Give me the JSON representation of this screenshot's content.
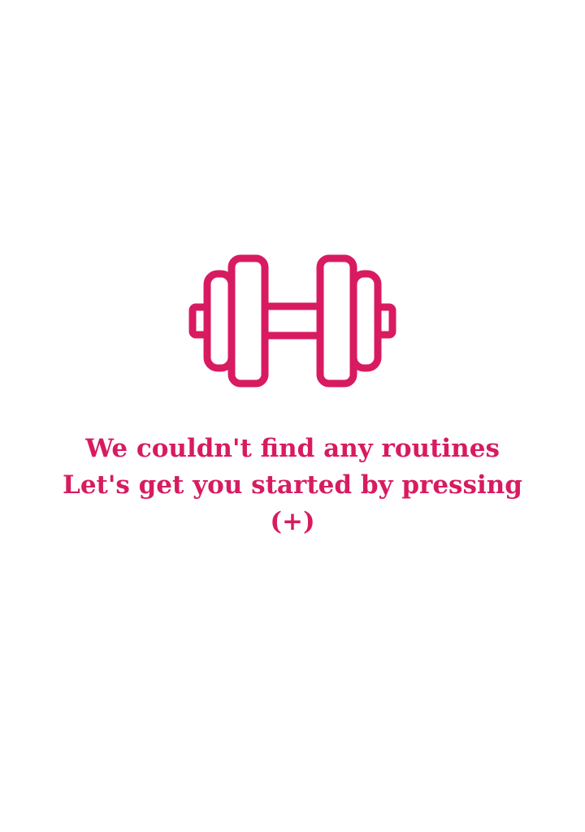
{
  "empty_state": {
    "icon": "dumbbell-icon",
    "line1": "We couldn't find any routines",
    "line2": "Let's get you started by pressing",
    "line3": "(+)"
  },
  "colors": {
    "accent": "#d81b60",
    "background": "#ffffff"
  }
}
